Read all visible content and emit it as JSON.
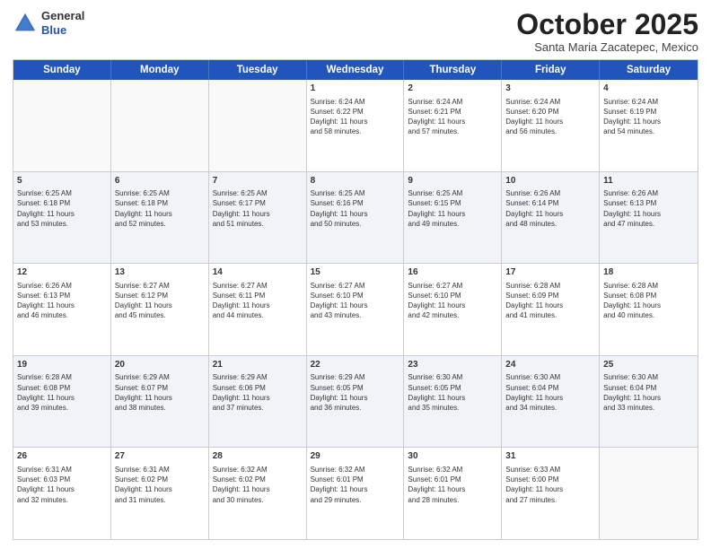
{
  "header": {
    "logo": {
      "general": "General",
      "blue": "Blue"
    },
    "title": "October 2025",
    "location": "Santa Maria Zacatepec, Mexico"
  },
  "days_of_week": [
    "Sunday",
    "Monday",
    "Tuesday",
    "Wednesday",
    "Thursday",
    "Friday",
    "Saturday"
  ],
  "weeks": [
    [
      {
        "day": "",
        "info": ""
      },
      {
        "day": "",
        "info": ""
      },
      {
        "day": "",
        "info": ""
      },
      {
        "day": "1",
        "info": "Sunrise: 6:24 AM\nSunset: 6:22 PM\nDaylight: 11 hours\nand 58 minutes."
      },
      {
        "day": "2",
        "info": "Sunrise: 6:24 AM\nSunset: 6:21 PM\nDaylight: 11 hours\nand 57 minutes."
      },
      {
        "day": "3",
        "info": "Sunrise: 6:24 AM\nSunset: 6:20 PM\nDaylight: 11 hours\nand 56 minutes."
      },
      {
        "day": "4",
        "info": "Sunrise: 6:24 AM\nSunset: 6:19 PM\nDaylight: 11 hours\nand 54 minutes."
      }
    ],
    [
      {
        "day": "5",
        "info": "Sunrise: 6:25 AM\nSunset: 6:18 PM\nDaylight: 11 hours\nand 53 minutes."
      },
      {
        "day": "6",
        "info": "Sunrise: 6:25 AM\nSunset: 6:18 PM\nDaylight: 11 hours\nand 52 minutes."
      },
      {
        "day": "7",
        "info": "Sunrise: 6:25 AM\nSunset: 6:17 PM\nDaylight: 11 hours\nand 51 minutes."
      },
      {
        "day": "8",
        "info": "Sunrise: 6:25 AM\nSunset: 6:16 PM\nDaylight: 11 hours\nand 50 minutes."
      },
      {
        "day": "9",
        "info": "Sunrise: 6:25 AM\nSunset: 6:15 PM\nDaylight: 11 hours\nand 49 minutes."
      },
      {
        "day": "10",
        "info": "Sunrise: 6:26 AM\nSunset: 6:14 PM\nDaylight: 11 hours\nand 48 minutes."
      },
      {
        "day": "11",
        "info": "Sunrise: 6:26 AM\nSunset: 6:13 PM\nDaylight: 11 hours\nand 47 minutes."
      }
    ],
    [
      {
        "day": "12",
        "info": "Sunrise: 6:26 AM\nSunset: 6:13 PM\nDaylight: 11 hours\nand 46 minutes."
      },
      {
        "day": "13",
        "info": "Sunrise: 6:27 AM\nSunset: 6:12 PM\nDaylight: 11 hours\nand 45 minutes."
      },
      {
        "day": "14",
        "info": "Sunrise: 6:27 AM\nSunset: 6:11 PM\nDaylight: 11 hours\nand 44 minutes."
      },
      {
        "day": "15",
        "info": "Sunrise: 6:27 AM\nSunset: 6:10 PM\nDaylight: 11 hours\nand 43 minutes."
      },
      {
        "day": "16",
        "info": "Sunrise: 6:27 AM\nSunset: 6:10 PM\nDaylight: 11 hours\nand 42 minutes."
      },
      {
        "day": "17",
        "info": "Sunrise: 6:28 AM\nSunset: 6:09 PM\nDaylight: 11 hours\nand 41 minutes."
      },
      {
        "day": "18",
        "info": "Sunrise: 6:28 AM\nSunset: 6:08 PM\nDaylight: 11 hours\nand 40 minutes."
      }
    ],
    [
      {
        "day": "19",
        "info": "Sunrise: 6:28 AM\nSunset: 6:08 PM\nDaylight: 11 hours\nand 39 minutes."
      },
      {
        "day": "20",
        "info": "Sunrise: 6:29 AM\nSunset: 6:07 PM\nDaylight: 11 hours\nand 38 minutes."
      },
      {
        "day": "21",
        "info": "Sunrise: 6:29 AM\nSunset: 6:06 PM\nDaylight: 11 hours\nand 37 minutes."
      },
      {
        "day": "22",
        "info": "Sunrise: 6:29 AM\nSunset: 6:05 PM\nDaylight: 11 hours\nand 36 minutes."
      },
      {
        "day": "23",
        "info": "Sunrise: 6:30 AM\nSunset: 6:05 PM\nDaylight: 11 hours\nand 35 minutes."
      },
      {
        "day": "24",
        "info": "Sunrise: 6:30 AM\nSunset: 6:04 PM\nDaylight: 11 hours\nand 34 minutes."
      },
      {
        "day": "25",
        "info": "Sunrise: 6:30 AM\nSunset: 6:04 PM\nDaylight: 11 hours\nand 33 minutes."
      }
    ],
    [
      {
        "day": "26",
        "info": "Sunrise: 6:31 AM\nSunset: 6:03 PM\nDaylight: 11 hours\nand 32 minutes."
      },
      {
        "day": "27",
        "info": "Sunrise: 6:31 AM\nSunset: 6:02 PM\nDaylight: 11 hours\nand 31 minutes."
      },
      {
        "day": "28",
        "info": "Sunrise: 6:32 AM\nSunset: 6:02 PM\nDaylight: 11 hours\nand 30 minutes."
      },
      {
        "day": "29",
        "info": "Sunrise: 6:32 AM\nSunset: 6:01 PM\nDaylight: 11 hours\nand 29 minutes."
      },
      {
        "day": "30",
        "info": "Sunrise: 6:32 AM\nSunset: 6:01 PM\nDaylight: 11 hours\nand 28 minutes."
      },
      {
        "day": "31",
        "info": "Sunrise: 6:33 AM\nSunset: 6:00 PM\nDaylight: 11 hours\nand 27 minutes."
      },
      {
        "day": "",
        "info": ""
      }
    ]
  ],
  "colors": {
    "header_bg": "#2255bb",
    "alt_row_bg": "#e8eef5"
  }
}
